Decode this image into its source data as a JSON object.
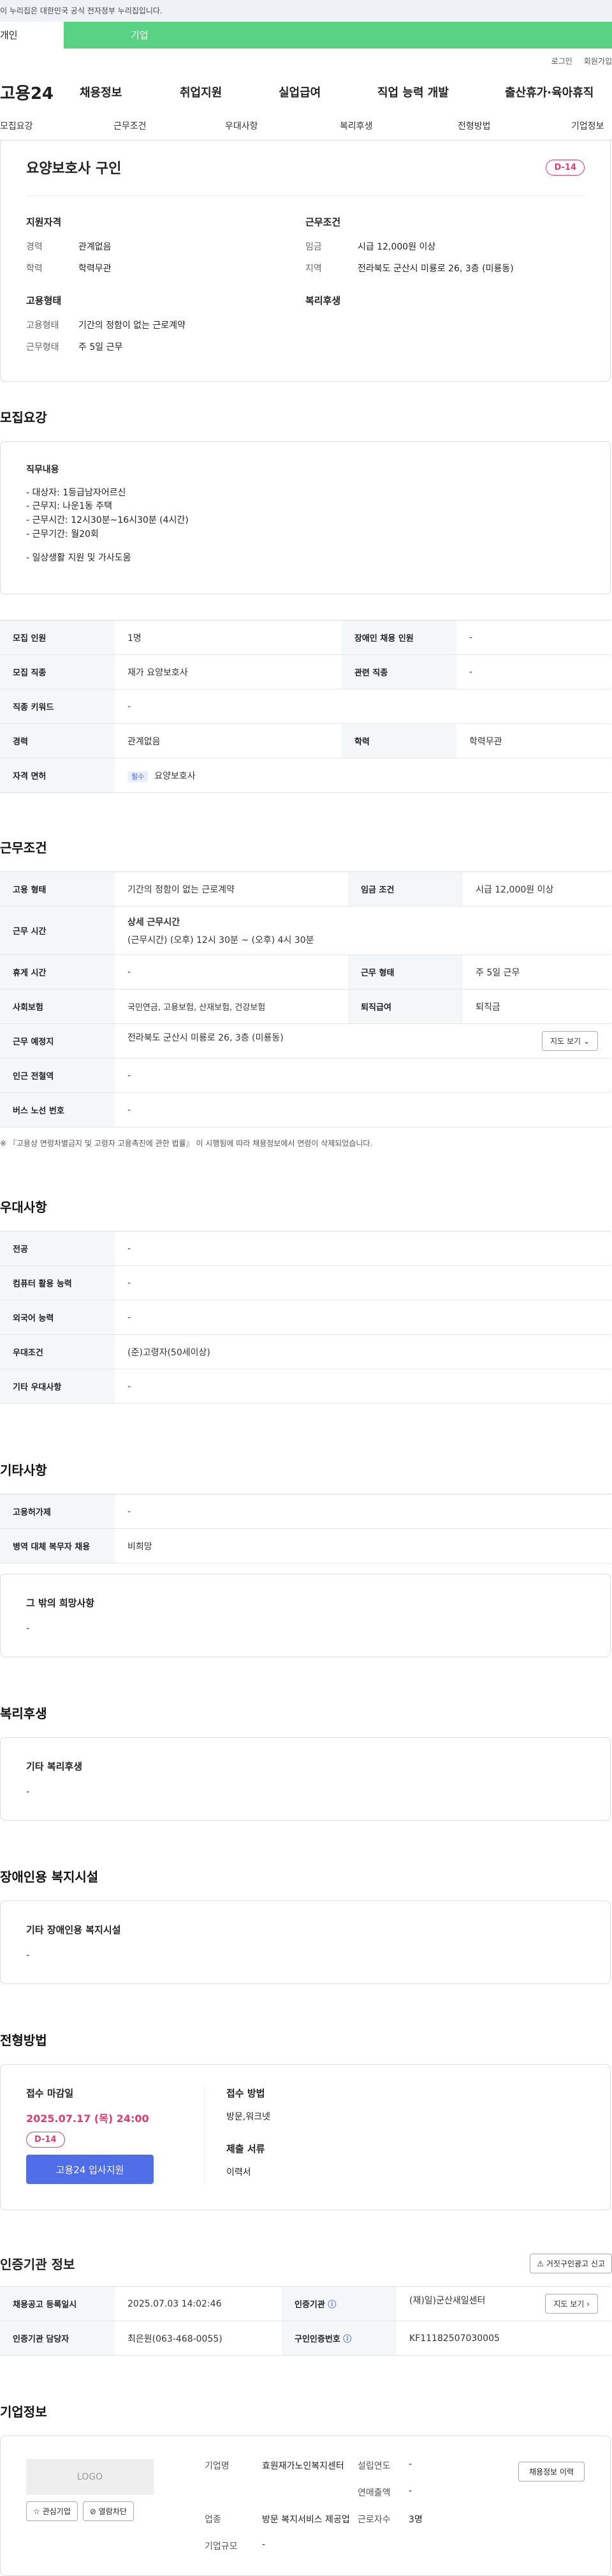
{
  "gov_banner": "이 누리집은 대한민국 공식 전자정부 누리집입니다.",
  "tabs": {
    "personal": "개인",
    "business": "기업"
  },
  "util": {
    "login": "로그인",
    "signup": "회원가입"
  },
  "gnb": {
    "logo": "고용24",
    "items": [
      "채용정보",
      "취업지원",
      "실업급여",
      "직업 능력 개발",
      "출산휴가·육아휴직"
    ]
  },
  "subnav": [
    "모집요강",
    "근무조건",
    "우대사항",
    "복리후생",
    "전형방법",
    "기업정보"
  ],
  "job": {
    "title": "요양보호사 구인",
    "dday": "D-14",
    "qual_h": "지원자격",
    "career_k": "경력",
    "career_v": "관계없음",
    "edu_k": "학력",
    "edu_v": "학력무관",
    "cond_h": "근무조건",
    "wage_k": "임금",
    "wage_v": "시급 12,000원 이상",
    "region_k": "지역",
    "region_v": "전라북도 군산시 미룡로 26, 3층 (미룡동)",
    "emp_h": "고용형태",
    "emptype_k": "고용형태",
    "emptype_v": "기간의 정함이 없는 근로계약",
    "workform_k": "근무형태",
    "workform_v": "주 5일 근무",
    "welfare_h": "복리후생"
  },
  "recruit": {
    "title": "모집요강",
    "duty_h": "직무내용",
    "duty_lines": [
      "- 대상자: 1등급남자어르신",
      "- 근무지: 나운1동 주택",
      "- 근무시간: 12시30분~16시30분 (4시간)",
      "- 근무기간: 월20회",
      "",
      "- 일상생활 지원 및 가사도움"
    ],
    "rows": {
      "count_k": "모집 인원",
      "count_v": "1명",
      "disabled_k": "장애인 채용 인원",
      "disabled_v": "-",
      "job_k": "모집 직종",
      "job_v": "재가 요양보호사",
      "related_k": "관련 직종",
      "related_v": "-",
      "keyword_k": "직종 키워드",
      "keyword_v": "-",
      "career_k": "경력",
      "career_v": "관계없음",
      "edu_k": "학력",
      "edu_v": "학력무관",
      "license_k": "자격 면허",
      "license_badge": "필수",
      "license_v": "요양보호사"
    }
  },
  "work": {
    "title": "근무조건",
    "emptype_k": "고용 형태",
    "emptype_v": "기간의 정함이 없는 근로계약",
    "wage_k": "임금 조건",
    "wage_v": "시급 12,000원 이상",
    "time_k": "근무 시간",
    "time_h": "상세 근무시간",
    "time_v": "(근무시간) (오후) 12시 30분 ~ (오후) 4시 30분",
    "rest_k": "휴게 시간",
    "rest_v": "-",
    "form_k": "근무 형태",
    "form_v": "주 5일 근무",
    "ins_k": "사회보험",
    "ins_v": "국민연금, 고용보험, 산재보험, 건강보험",
    "ret_k": "퇴직급여",
    "ret_v": "퇴직금",
    "place_k": "근무 예정지",
    "place_v": "전라북도 군산시 미룡로 26, 3층 (미룡동)",
    "map_btn": "지도 보기",
    "subway_k": "인근 전철역",
    "subway_v": "-",
    "bus_k": "버스 노선 번호",
    "bus_v": "-",
    "note": "※ 『고용상 연령차별금지 및 고령자 고용촉진에 관한 법률』 이 시행됨에 따라 채용정보에서 연령이 삭제되었습니다."
  },
  "pref": {
    "title": "우대사항",
    "major_k": "전공",
    "major_v": "-",
    "pc_k": "컴퓨터 활용 능력",
    "pc_v": "-",
    "lang_k": "외국어 능력",
    "lang_v": "-",
    "cond_k": "우대조건",
    "cond_v": "(준)고령자(50세이상)",
    "etc_k": "기타 우대사항",
    "etc_v": "-"
  },
  "other": {
    "title": "기타사항",
    "permit_k": "고용허가제",
    "permit_v": "-",
    "military_k": "병역 대체 복무자 채용",
    "military_v": "비희망",
    "wish_h": "그 밖의 희망사항",
    "wish_v": "-"
  },
  "welfare": {
    "title": "복리후생",
    "h": "기타 복리후생",
    "v": "-"
  },
  "disabled": {
    "title": "장애인용 복지시설",
    "h": "기타 장애인용 복지시설",
    "v": "-"
  },
  "process": {
    "title": "전형방법",
    "deadline_h": "접수 마감일",
    "deadline_v": "2025.07.17 (목) 24:00",
    "dday": "D-14",
    "apply_btn": "고용24 입사지원",
    "method_h": "접수 방법",
    "method_v": "방문,워크넷",
    "docs_h": "제출 서류",
    "docs_v": "이력서"
  },
  "cert": {
    "title": "인증기관 정보",
    "report_btn": "거짓구인광고 신고",
    "reg_k": "채용공고 등록일시",
    "reg_v": "2025.07.03 14:02:46",
    "org_k": "인증기관",
    "org_v": "(재)일)군산새일센터",
    "manager_k": "인증기관 담당자",
    "manager_v": "최은원(063-468-0055)",
    "certno_k": "구인인증번호",
    "certno_v": "KF11182507030005",
    "map_btn": "지도 보기"
  },
  "company": {
    "title": "기업정보",
    "logo": "LOGO",
    "fav_btn": "관심기업",
    "block_btn": "열람차단",
    "name_k": "기업명",
    "name_v": "효원재가노인복지센터",
    "year_k": "설립연도",
    "year_v": "-",
    "sales_k": "연매출액",
    "sales_v": "-",
    "industry_k": "업종",
    "industry_v": "방문 복지서비스 제공업",
    "emp_k": "근로자수",
    "emp_v": "3명",
    "size_k": "기업규모",
    "size_v": "-",
    "history_btn": "채용정보 이력"
  }
}
